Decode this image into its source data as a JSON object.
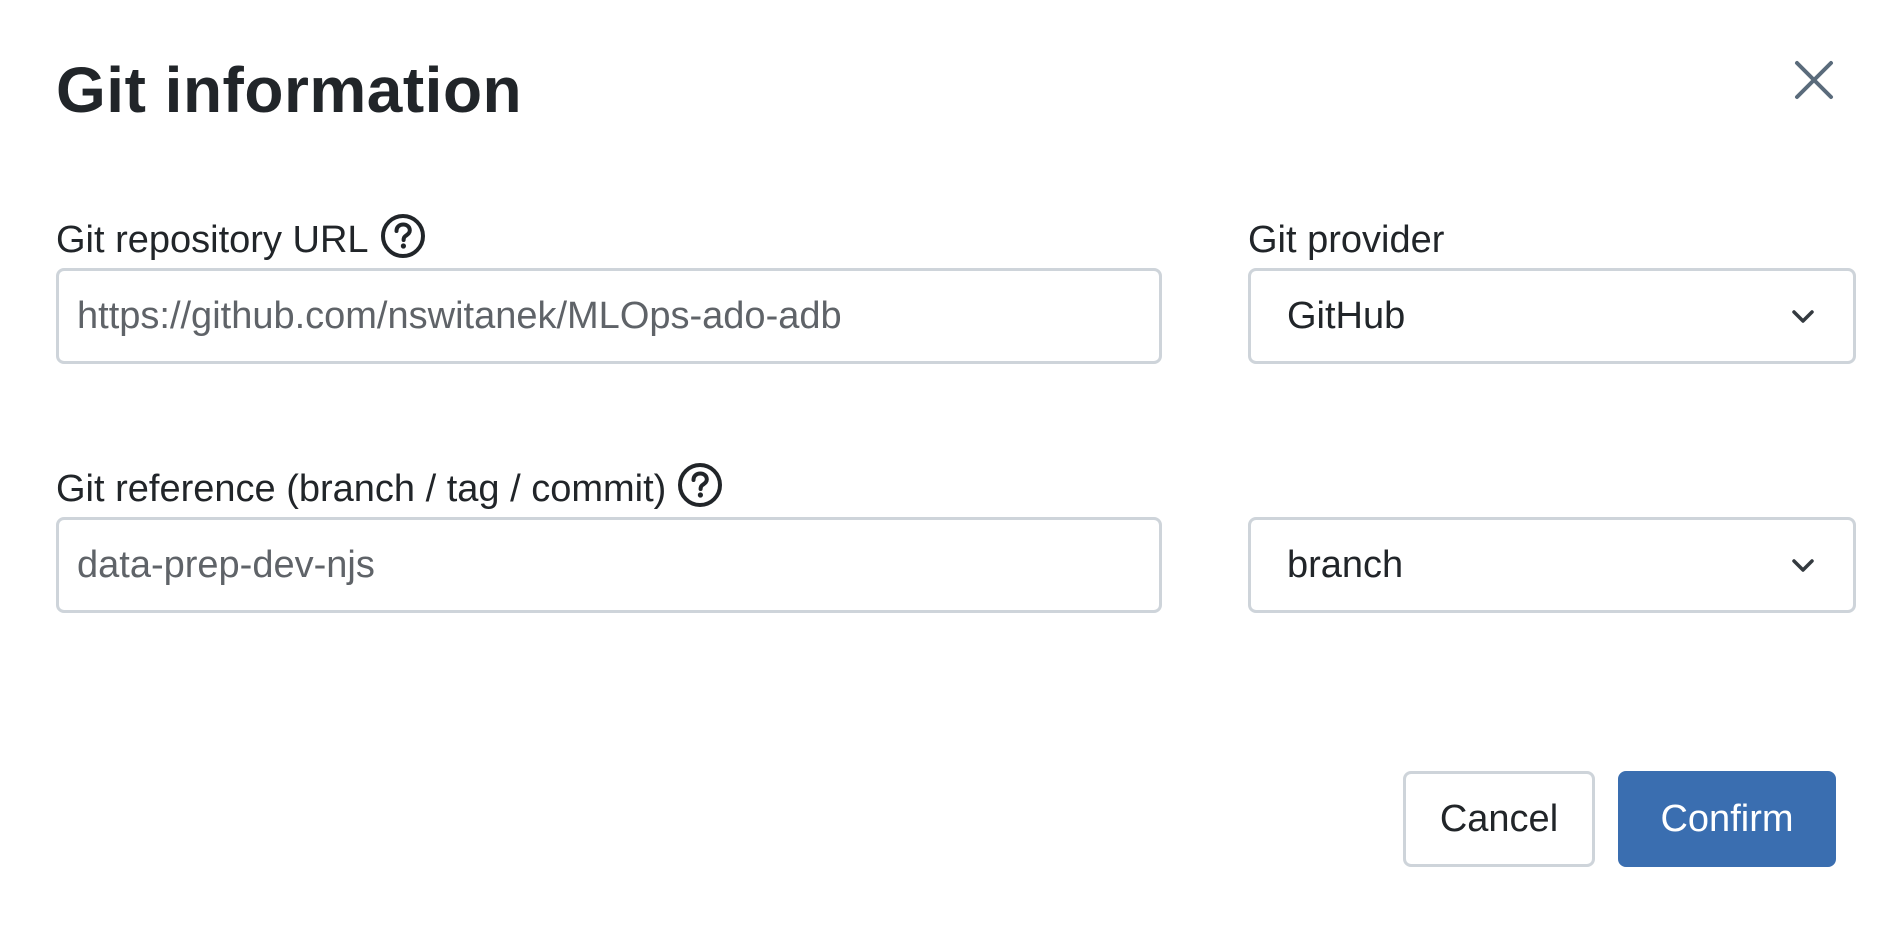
{
  "dialog": {
    "title": "Git information",
    "close_icon": "close-icon"
  },
  "repo_url": {
    "label": "Git repository URL",
    "help_icon": "question-circle-icon",
    "value": "https://github.com/nswitanek/MLOps-ado-adb"
  },
  "provider": {
    "label": "Git provider",
    "selected": "GitHub",
    "chevron_icon": "chevron-down-icon"
  },
  "reference": {
    "label": "Git reference (branch / tag / commit)",
    "help_icon": "question-circle-icon",
    "value": "data-prep-dev-njs"
  },
  "reference_type": {
    "selected": "branch",
    "chevron_icon": "chevron-down-icon"
  },
  "actions": {
    "cancel_label": "Cancel",
    "confirm_label": "Confirm"
  },
  "colors": {
    "primary": "#3a6eb0",
    "border": "#ced4da",
    "text": "#212529"
  }
}
